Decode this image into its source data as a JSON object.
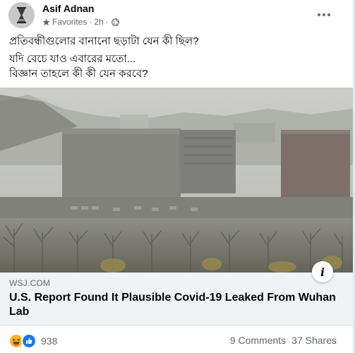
{
  "post": {
    "author": "Asif Adnan",
    "audience_label": "Favorites",
    "separator": "·",
    "time": "2h",
    "audience_icon": "star-icon",
    "privacy_icon": "globe-icon",
    "more_icon": "more-options-icon",
    "text_lines": [
      "প্রতিবন্ধীগুলোর বানানো ছড়াটা যেন কী ছিল?",
      "যদি বেচে যাও এবারের মতো...",
      "বিজ্ঞান তাহলে কী কী যেন করবে?"
    ]
  },
  "link_preview": {
    "domain": "WSJ.COM",
    "headline": "U.S. Report Found It Plausible Covid-19 Leaked From Wuhan Lab",
    "info_label": "i"
  },
  "footer": {
    "reaction_icons": [
      "haha-icon",
      "like-icon"
    ],
    "reaction_count": "938",
    "comments": "9 Comments",
    "shares": "37 Shares"
  },
  "colors": {
    "secondary_text": "#65676b",
    "link_bg": "#f0f2f5",
    "like_blue": "#1877f2",
    "haha_yellow": "#f7b125"
  }
}
